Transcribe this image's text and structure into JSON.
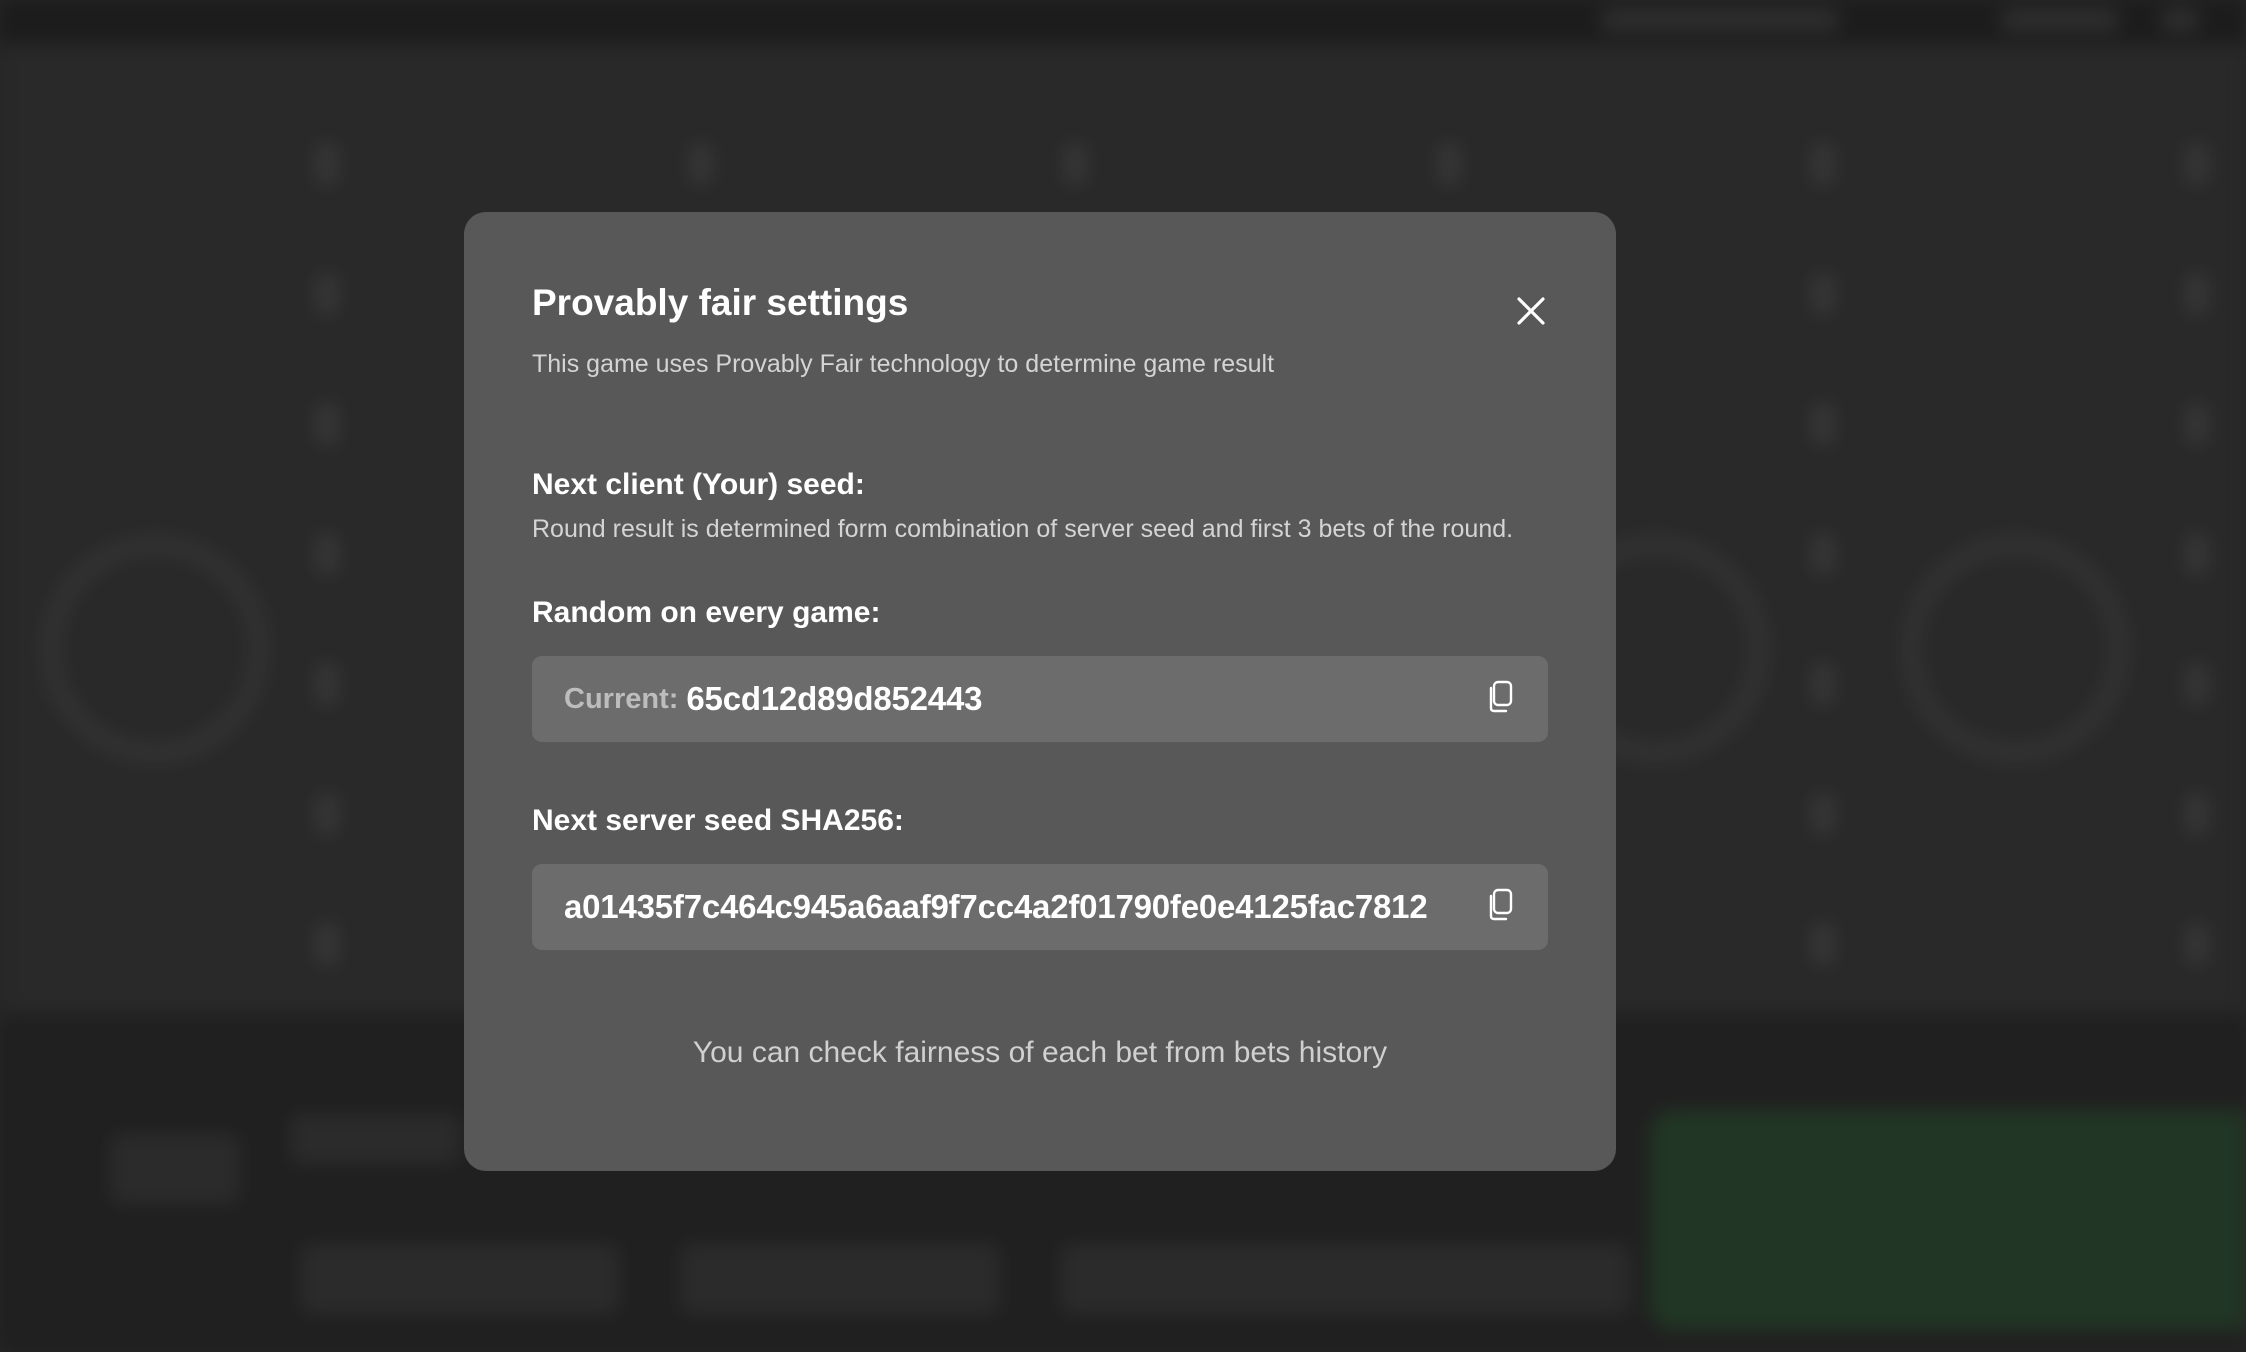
{
  "modal": {
    "title": "Provably fair settings",
    "subtitle": "This game uses Provably Fair technology to determine game result",
    "client_seed": {
      "label": "Next client (Your) seed:",
      "description": "Round result is determined form combination of server seed and first 3 bets of the round.",
      "mode_label": "Random on every game:",
      "current_prefix": "Current:",
      "current_value": "65cd12d89d852443"
    },
    "server_seed": {
      "label": "Next server seed SHA256:",
      "value": "a01435f7c464c945a6aaf9f7cc4a2f01790fe0e4125fac7812"
    },
    "footer_note": "You can check fairness of each bet from bets history"
  },
  "icons": {
    "close": "close-icon",
    "copy": "copy-icon"
  },
  "colors": {
    "modal_bg": "#585858",
    "field_bg": "#6c6c6c",
    "page_bg": "#2b2b2b",
    "play_button_bg": "#26422a"
  }
}
